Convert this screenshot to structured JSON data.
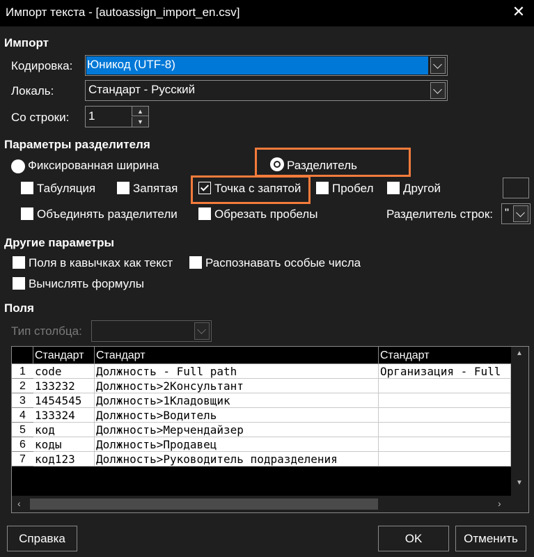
{
  "window": {
    "title": "Импорт текста - [autoassign_import_en.csv]"
  },
  "import": {
    "heading": "Импорт",
    "encoding_label": "Кодировка:",
    "encoding_value": "Юникод (UTF-8)",
    "locale_label": "Локаль:",
    "locale_value": "Стандарт - Русский",
    "from_row_label": "Со строки:",
    "from_row_value": "1"
  },
  "separator": {
    "heading": "Параметры разделителя",
    "fixed_width": "Фиксированная ширина",
    "separated_by": "Разделитель",
    "tab": "Табуляция",
    "comma": "Запятая",
    "semicolon": "Точка с запятой",
    "space": "Пробел",
    "other": "Другой",
    "merge": "Объединять разделители",
    "trim": "Обрезать пробелы",
    "string_delim_label": "Разделитель строк:",
    "string_delim_value": "\""
  },
  "other_options": {
    "heading": "Другие параметры",
    "quoted_as_text": "Поля в кавычках как текст",
    "detect_special": "Распознавать особые числа",
    "evaluate_formulas": "Вычислять формулы"
  },
  "fields": {
    "heading": "Поля",
    "column_type_label": "Тип столбца:",
    "column_headers": [
      "Стандарт",
      "Стандарт",
      "Стандарт"
    ],
    "rows": [
      {
        "num": "1",
        "cells": [
          "code",
          "Должность - Full path",
          "Организация - Full"
        ]
      },
      {
        "num": "2",
        "cells": [
          "133232",
          "Должность>2Консультант",
          ""
        ]
      },
      {
        "num": "3",
        "cells": [
          "1454545",
          "Должность>1Кладовщик",
          ""
        ]
      },
      {
        "num": "4",
        "cells": [
          "133324",
          "Должность>Водитель",
          ""
        ]
      },
      {
        "num": "5",
        "cells": [
          "код",
          "Должность>Мерчендайзер",
          ""
        ]
      },
      {
        "num": "6",
        "cells": [
          "коды",
          "Должность>Продавец",
          ""
        ]
      },
      {
        "num": "7",
        "cells": [
          "код123",
          "Должность>Руководитель подразделения",
          ""
        ]
      }
    ]
  },
  "buttons": {
    "help": "Справка",
    "ok": "OK",
    "cancel": "Отменить"
  },
  "colors": {
    "accent": "#0078d7",
    "highlight": "#f47b3b",
    "dialog_bg": "#1f1f1f"
  },
  "state": {
    "separated_selected": true,
    "semicolon_checked": true
  }
}
